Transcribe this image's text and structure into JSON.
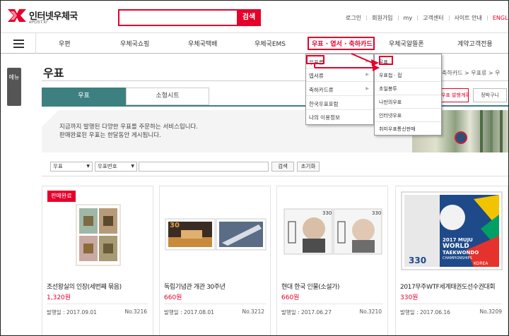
{
  "brand": {
    "title": "인터넷우체국",
    "subtitle": "ePOST.kr"
  },
  "search": {
    "button": "검색",
    "value": ""
  },
  "toplinks": [
    "로그인",
    "회원가입",
    "my",
    "고객센터",
    "사이트 안내",
    "ENGLISH"
  ],
  "gnb": [
    "우편",
    "우체국쇼핑",
    "우체국택배",
    "우체국EMS",
    "우표 · 엽서 · 축하카드",
    "우체국알뜰폰",
    "계약고객전용"
  ],
  "side_tab": "메뉴",
  "page_title": "우표",
  "breadcrumb": "축하카드 > 우표류 > 우",
  "tabs": [
    "우표",
    "소형시트"
  ],
  "right_buttons": [
    "우표 발행계획",
    "정박구니"
  ],
  "banner_lines": [
    "지금까지 발행된 다양한 우표를 주문하는 서비스입니다.",
    "판매완료된 우표는 한달동안 게시됩니다."
  ],
  "filters": {
    "category": "우표",
    "field": "우표번호",
    "keyword": "",
    "search_button": "검색",
    "reset_button": "초기화"
  },
  "menu_level1": [
    "우표류",
    "엽서류",
    "축하카드류",
    "한국우표포럼",
    "나의 이용정보"
  ],
  "menu_level2": [
    "우표",
    "우표첩 · 접",
    "초일봉투",
    "나만의우표",
    "인터넷우표",
    "취미우표통신판매"
  ],
  "products": [
    {
      "badge": "판매완료",
      "name": "조선왕실의 인장(세번째 묶음)",
      "price": "1,320원",
      "date": "발행일 : 2017.09.01",
      "no": "No.3216"
    },
    {
      "name": "독립기념관 개관 30주년",
      "price": "660원",
      "date": "발행일 : 2017.08.01",
      "no": "No.3212"
    },
    {
      "name": "현대 한국 인물(소설가)",
      "price": "660원",
      "date": "발행일 : 2017.06.27",
      "no": "No.3210"
    },
    {
      "name": "2017무주WTF세계태권도선수권대회",
      "price": "330원",
      "date": "발행일 : 2017.06.16",
      "no": "No.3209"
    }
  ],
  "stamp_texts": {
    "value_330": "330",
    "value_30": "30",
    "wtf_line1": "2017 MUJU",
    "wtf_line2": "WORLD",
    "wtf_line3": "TAEKWONDO",
    "wtf_line4": "CHAMPIONSHIPS",
    "korea": "KOREA"
  },
  "colors": {
    "accent": "#e4002b",
    "teal": "#3d8080"
  }
}
